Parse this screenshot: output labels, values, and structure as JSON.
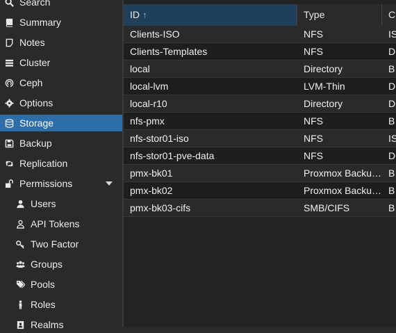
{
  "sidebar": {
    "items": [
      {
        "label": "Search",
        "icon": "search-icon"
      },
      {
        "label": "Summary",
        "icon": "book-icon"
      },
      {
        "label": "Notes",
        "icon": "note-icon"
      },
      {
        "label": "Cluster",
        "icon": "server-icon"
      },
      {
        "label": "Ceph",
        "icon": "ceph-icon"
      },
      {
        "label": "Options",
        "icon": "gear-icon"
      },
      {
        "label": "Storage",
        "icon": "database-icon",
        "active": true
      },
      {
        "label": "Backup",
        "icon": "floppy-icon"
      },
      {
        "label": "Replication",
        "icon": "retweet-icon"
      },
      {
        "label": "Permissions",
        "icon": "unlock-icon",
        "expanded": true
      },
      {
        "label": "Users",
        "icon": "user-icon"
      },
      {
        "label": "API Tokens",
        "icon": "user-outline-icon"
      },
      {
        "label": "Two Factor",
        "icon": "key-icon"
      },
      {
        "label": "Groups",
        "icon": "users-icon"
      },
      {
        "label": "Pools",
        "icon": "tags-icon"
      },
      {
        "label": "Roles",
        "icon": "male-icon"
      },
      {
        "label": "Realms",
        "icon": "address-book-icon"
      }
    ]
  },
  "grid": {
    "columns": [
      "ID",
      "Type",
      "C"
    ],
    "sort_indicator": "↑",
    "rows": [
      {
        "id": "Clients-ISO",
        "type": "NFS",
        "third": "IS"
      },
      {
        "id": "Clients-Templates",
        "type": "NFS",
        "third": "D"
      },
      {
        "id": "local",
        "type": "Directory",
        "third": "B"
      },
      {
        "id": "local-lvm",
        "type": "LVM-Thin",
        "third": "D"
      },
      {
        "id": "local-r10",
        "type": "Directory",
        "third": "D"
      },
      {
        "id": "nfs-pmx",
        "type": "NFS",
        "third": "B"
      },
      {
        "id": "nfs-stor01-iso",
        "type": "NFS",
        "third": "IS"
      },
      {
        "id": "nfs-stor01-pve-data",
        "type": "NFS",
        "third": "D"
      },
      {
        "id": "pmx-bk01",
        "type": "Proxmox Backu…",
        "third": "B"
      },
      {
        "id": "pmx-bk02",
        "type": "Proxmox Backu…",
        "third": "B"
      },
      {
        "id": "pmx-bk03-cifs",
        "type": "SMB/CIFS",
        "third": "B"
      }
    ]
  },
  "colors": {
    "active": "#2d6ea8",
    "sorted_header": "#1f3f5a"
  }
}
